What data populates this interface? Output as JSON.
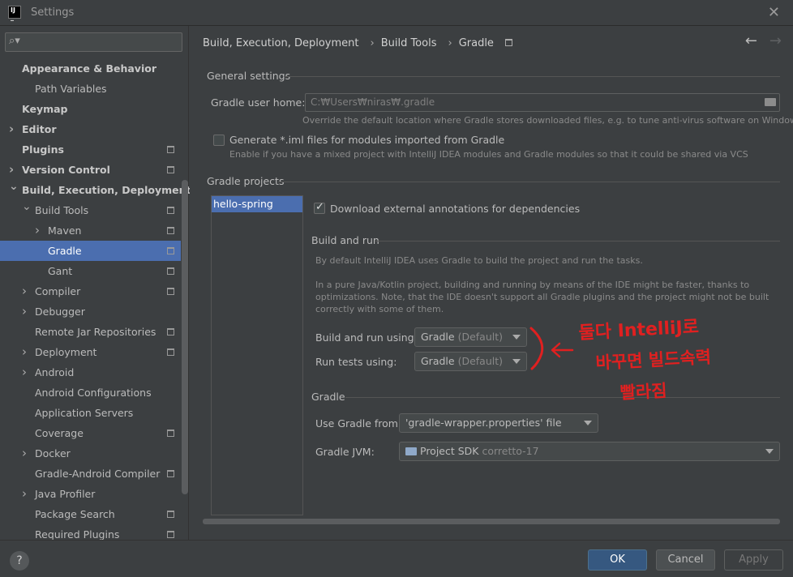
{
  "window": {
    "title": "Settings"
  },
  "sidebar": {
    "search_placeholder": "",
    "items": [
      {
        "label": "Appearance & Behavior",
        "bold": true,
        "indent": 0,
        "arrow": "",
        "sq": false,
        "selected": false
      },
      {
        "label": "Path Variables",
        "bold": false,
        "indent": 1,
        "arrow": "",
        "sq": false,
        "selected": false
      },
      {
        "label": "Keymap",
        "bold": true,
        "indent": 0,
        "arrow": "",
        "sq": false,
        "selected": false
      },
      {
        "label": "Editor",
        "bold": true,
        "indent": 0,
        "arrow": "right",
        "sq": false,
        "selected": false
      },
      {
        "label": "Plugins",
        "bold": true,
        "indent": 0,
        "arrow": "",
        "sq": true,
        "selected": false
      },
      {
        "label": "Version Control",
        "bold": true,
        "indent": 0,
        "arrow": "right",
        "sq": true,
        "selected": false
      },
      {
        "label": "Build, Execution, Deployment",
        "bold": true,
        "indent": 0,
        "arrow": "down",
        "sq": false,
        "selected": false
      },
      {
        "label": "Build Tools",
        "bold": false,
        "indent": 1,
        "arrow": "down",
        "sq": true,
        "selected": false
      },
      {
        "label": "Maven",
        "bold": false,
        "indent": 2,
        "arrow": "right",
        "sq": true,
        "selected": false
      },
      {
        "label": "Gradle",
        "bold": false,
        "indent": 2,
        "arrow": "",
        "sq": true,
        "selected": true
      },
      {
        "label": "Gant",
        "bold": false,
        "indent": 2,
        "arrow": "",
        "sq": true,
        "selected": false
      },
      {
        "label": "Compiler",
        "bold": false,
        "indent": 1,
        "arrow": "right",
        "sq": true,
        "selected": false
      },
      {
        "label": "Debugger",
        "bold": false,
        "indent": 1,
        "arrow": "right",
        "sq": false,
        "selected": false
      },
      {
        "label": "Remote Jar Repositories",
        "bold": false,
        "indent": 1,
        "arrow": "",
        "sq": true,
        "selected": false
      },
      {
        "label": "Deployment",
        "bold": false,
        "indent": 1,
        "arrow": "right",
        "sq": true,
        "selected": false
      },
      {
        "label": "Android",
        "bold": false,
        "indent": 1,
        "arrow": "right",
        "sq": false,
        "selected": false
      },
      {
        "label": "Android Configurations",
        "bold": false,
        "indent": 1,
        "arrow": "",
        "sq": false,
        "selected": false
      },
      {
        "label": "Application Servers",
        "bold": false,
        "indent": 1,
        "arrow": "",
        "sq": false,
        "selected": false
      },
      {
        "label": "Coverage",
        "bold": false,
        "indent": 1,
        "arrow": "",
        "sq": true,
        "selected": false
      },
      {
        "label": "Docker",
        "bold": false,
        "indent": 1,
        "arrow": "right",
        "sq": false,
        "selected": false
      },
      {
        "label": "Gradle-Android Compiler",
        "bold": false,
        "indent": 1,
        "arrow": "",
        "sq": true,
        "selected": false
      },
      {
        "label": "Java Profiler",
        "bold": false,
        "indent": 1,
        "arrow": "right",
        "sq": false,
        "selected": false
      },
      {
        "label": "Package Search",
        "bold": false,
        "indent": 1,
        "arrow": "",
        "sq": true,
        "selected": false
      },
      {
        "label": "Required Plugins",
        "bold": false,
        "indent": 1,
        "arrow": "",
        "sq": true,
        "selected": false
      }
    ]
  },
  "breadcrumb": {
    "part1": "Build, Execution, Deployment",
    "part2": "Build Tools",
    "part3": "Gradle"
  },
  "general": {
    "title": "General settings",
    "user_home_label": "Gradle user home:",
    "user_home_value": "C:₩Users₩niras₩.gradle",
    "user_home_hint": "Override the default location where Gradle stores downloaded files, e.g. to tune anti-virus software on Windows",
    "iml_label": "Generate *.iml files for modules imported from Gradle",
    "iml_checked": false,
    "iml_hint": "Enable if you have a mixed project with IntelliJ IDEA modules and Gradle modules so that it could be shared via VCS"
  },
  "projects": {
    "title": "Gradle projects",
    "list": [
      "hello-spring"
    ],
    "download_label": "Download external annotations for dependencies",
    "download_checked": true
  },
  "build_run": {
    "title": "Build and run",
    "desc1": "By default IntelliJ IDEA uses Gradle to build the project and run the tasks.",
    "desc2_line1": "In a pure Java/Kotlin project, building and running by means of the IDE might be faster, thanks to",
    "desc2_line2": "optimizations. Note, that the IDE doesn't support all Gradle plugins and the project might not be built",
    "desc2_line3": "correctly with some of them.",
    "build_label": "Build and run using:",
    "build_value": "Gradle",
    "build_default": "(Default)",
    "tests_label": "Run tests using:",
    "tests_value": "Gradle",
    "tests_default": "(Default)"
  },
  "gradle": {
    "title": "Gradle",
    "use_from_label": "Use Gradle from:",
    "use_from_value": "'gradle-wrapper.properties' file",
    "jvm_label": "Gradle JVM:",
    "jvm_value": "Project SDK",
    "jvm_detail": "corretto-17"
  },
  "annotation": {
    "line1": "둘다 IntelliJ로",
    "line2": "바꾸면 빌드속력",
    "line3": "빨라짐",
    "color": "#e02020"
  },
  "footer": {
    "help": "?",
    "ok": "OK",
    "cancel": "Cancel",
    "apply": "Apply"
  },
  "colors": {
    "selection": "#4b6eaf",
    "background": "#3c3f41",
    "ok_button": "#365880"
  }
}
